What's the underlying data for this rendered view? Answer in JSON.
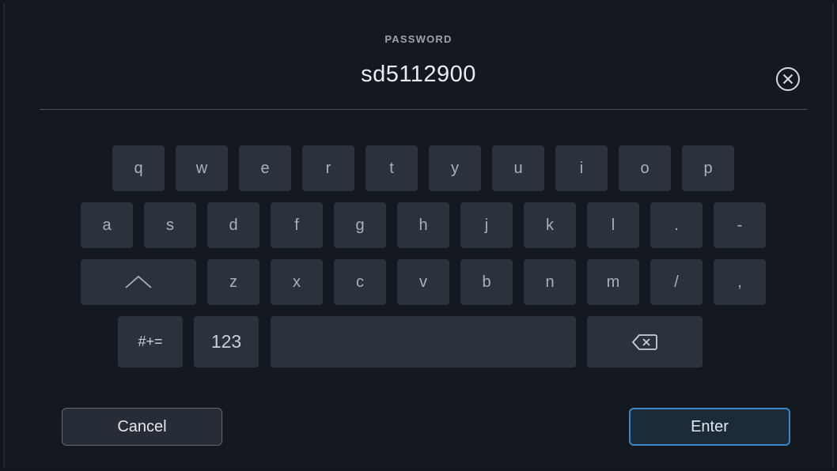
{
  "password_field": {
    "label": "PASSWORD",
    "value": "sd5112900"
  },
  "keyboard": {
    "row1": [
      "q",
      "w",
      "e",
      "r",
      "t",
      "y",
      "u",
      "i",
      "o",
      "p"
    ],
    "row2": [
      "a",
      "s",
      "d",
      "f",
      "g",
      "h",
      "j",
      "k",
      "l",
      ".",
      "-"
    ],
    "row3": [
      "z",
      "x",
      "c",
      "v",
      "b",
      "n",
      "m",
      "/",
      ","
    ],
    "symbols_label": "#+=",
    "numbers_label": "123"
  },
  "actions": {
    "cancel_label": "Cancel",
    "enter_label": "Enter"
  },
  "colors": {
    "background": "#141920",
    "key": "#2a323d",
    "accent": "#3a86c8"
  },
  "icons": [
    "clear-circle-x-icon",
    "shift-arrow-icon",
    "backspace-icon"
  ]
}
